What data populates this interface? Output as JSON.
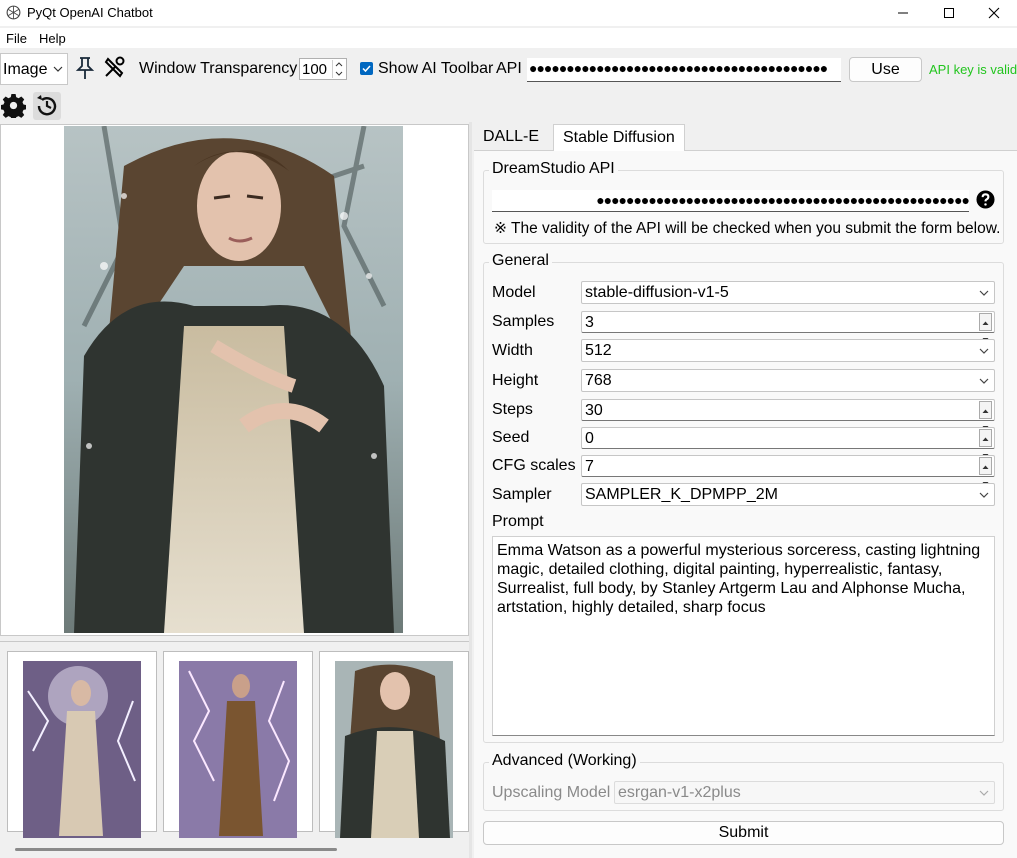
{
  "window": {
    "title": "PyQt OpenAI Chatbot"
  },
  "menu": {
    "items": [
      "File",
      "Help"
    ]
  },
  "toolbar": {
    "mode_value": "Image",
    "transparency_label": "Window Transparency",
    "transparency_value": "100",
    "show_ai_toolbar_label": "Show AI Toolbar",
    "show_ai_toolbar_checked": true,
    "api_label": "API",
    "api_value": "●●●●●●●●●●●●●●●●●●●●●●●●●●●●●●●●●●●●●●●●",
    "use_label": "Use",
    "api_status": "API key is valid",
    "api_status_color": "#22c51e"
  },
  "toolbar2": {
    "icons": [
      "settings-icon",
      "history-icon"
    ]
  },
  "tabs": [
    "DALL-E",
    "Stable Diffusion"
  ],
  "active_tab": "Stable Diffusion",
  "dreamstudio": {
    "title": "DreamStudio API",
    "key_value": "●●●●●●●●●●●●●●●●●●●●●●●●●●●●●●●●●●●●●●●●●●●●●●●●●●",
    "note": "※ The validity of the API will be checked when you submit the form below."
  },
  "general": {
    "title": "General",
    "model_label": "Model",
    "model_value": "stable-diffusion-v1-5",
    "samples_label": "Samples",
    "samples_value": "3",
    "width_label": "Width",
    "width_value": "512",
    "height_label": "Height",
    "height_value": "768",
    "steps_label": "Steps",
    "steps_value": "30",
    "seed_label": "Seed",
    "seed_value": "0",
    "cfg_label": "CFG scales",
    "cfg_value": "7",
    "sampler_label": "Sampler",
    "sampler_value": "SAMPLER_K_DPMPP_2M",
    "prompt_label": "Prompt",
    "prompt_value": "Emma Watson as a powerful mysterious sorceress, casting lightning magic, detailed clothing, digital painting, hyperrealistic, fantasy, Surrealist, full body, by Stanley Artgerm Lau and Alphonse Mucha, artstation, highly detailed, sharp focus"
  },
  "advanced": {
    "title": "Advanced (Working)",
    "upscaling_label": "Upscaling Model",
    "upscaling_value": "esrgan-v1-x2plus"
  },
  "submit_label": "Submit"
}
